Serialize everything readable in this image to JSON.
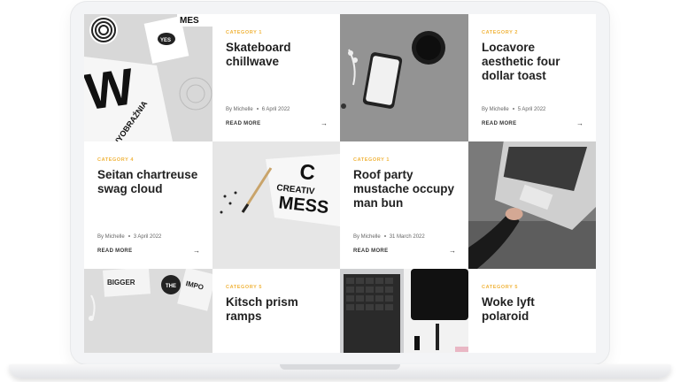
{
  "cards": [
    {
      "category": "CATEGORY 1",
      "title": "Skateboard chillwave",
      "author": "By Michelle",
      "date": "6 April 2022",
      "read_more": "READ MORE"
    },
    {
      "category": "CATEGORY 2",
      "title": "Locavore aesthetic four dollar toast",
      "author": "By Michelle",
      "date": "5 April 2022",
      "read_more": "READ MORE"
    },
    {
      "category": "CATEGORY 4",
      "title": "Seitan chartreuse swag cloud",
      "author": "By Michelle",
      "date": "3 April 2022",
      "read_more": "READ MORE"
    },
    {
      "category": "CATEGORY 1",
      "title": "Roof party mustache occupy man bun",
      "author": "By Michelle",
      "date": "31 March 2022",
      "read_more": "READ MORE"
    },
    {
      "category": "CATEGORY 5",
      "title": "Kitsch prism ramps"
    },
    {
      "category": "CATEGORY 5",
      "title": "Woke lyft polaroid"
    }
  ],
  "photos": {
    "p1": {
      "text_top": "MES",
      "text_main": "W",
      "text_caption": "WYOBRAŹNIA",
      "badge": "YES"
    },
    "p3": {
      "text_big": "C",
      "text_a": "CREATIV",
      "text_b": "MESS"
    },
    "p5": {
      "text_a": "BIGGER",
      "text_b": "THE",
      "text_c": "IMPO"
    }
  },
  "colors": {
    "accent": "#f0b43c",
    "title": "#222222"
  },
  "icons": {
    "arrow": "→"
  }
}
